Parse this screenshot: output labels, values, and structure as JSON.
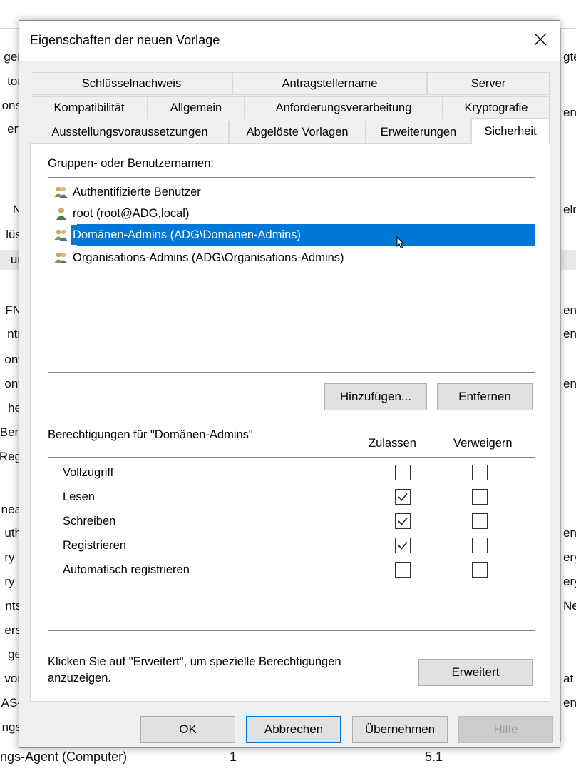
{
  "background": {
    "left_fragments": [
      "ger",
      "tor",
      "ons",
      "ert",
      "N",
      "lüs",
      "ur",
      "FN",
      "ntr",
      "ont",
      "ont",
      "he",
      "Ben",
      "Reg",
      "nea",
      "uth",
      "ry .",
      "ry .",
      "nts",
      "ers",
      "ge",
      "vor",
      "AS-",
      "ngs"
    ],
    "right_fragments": [
      "gte",
      "en",
      "eln",
      "en",
      "en",
      "en",
      "en",
      "ery",
      "ery",
      "Ne",
      "at",
      "en"
    ],
    "bottom_row": {
      "name": "ngs-Agent (Computer)",
      "number": "1",
      "version": "5.1"
    }
  },
  "dialog": {
    "title": "Eigenschaften der neuen Vorlage",
    "close_icon": "close-icon",
    "tabs_row1": [
      "Schlüsselnachweis",
      "Antragstellername",
      "Server"
    ],
    "tabs_row2": [
      "Kompatibilität",
      "Allgemein",
      "Anforderungsverarbeitung",
      "Kryptografie"
    ],
    "tabs_row3": [
      "Ausstellungsvoraussetzungen",
      "Abgelöste Vorlagen",
      "Erweiterungen",
      "Sicherheit"
    ],
    "active_tab": "Sicherheit",
    "groups_label": "Gruppen- oder Benutzernamen:",
    "principals": [
      {
        "name": "Authentifizierte Benutzer",
        "icon": "group-users-icon"
      },
      {
        "name": "root (root@ADG,local)",
        "icon": "user-icon"
      },
      {
        "name": "Domänen-Admins (ADG\\Domänen-Admins)",
        "icon": "group-users-icon",
        "selected": true
      },
      {
        "name": "Organisations-Admins (ADG\\Organisations-Admins)",
        "icon": "group-users-icon"
      }
    ],
    "add_button": "Hinzufügen...",
    "remove_button": "Entfernen",
    "permissions_label": "Berechtigungen für \"Domänen-Admins\"",
    "allow_header": "Zulassen",
    "deny_header": "Verweigern",
    "permissions": [
      {
        "name": "Vollzugriff",
        "allow": false,
        "deny": false
      },
      {
        "name": "Lesen",
        "allow": true,
        "deny": false
      },
      {
        "name": "Schreiben",
        "allow": true,
        "deny": false
      },
      {
        "name": "Registrieren",
        "allow": true,
        "deny": false
      },
      {
        "name": "Automatisch registrieren",
        "allow": false,
        "deny": false
      }
    ],
    "advanced_hint_line1": "Klicken Sie auf \"Erweitert\", um spezielle Berechtigungen",
    "advanced_hint_line2": "anzuzeigen.",
    "advanced_button": "Erweitert",
    "ok_button": "OK",
    "cancel_button": "Abbrechen",
    "apply_button": "Übernehmen",
    "help_button": "Hilfe",
    "colors": {
      "selection": "#0078d7",
      "dialog_bg": "#f0f0f0",
      "button_bg": "#e1e1e1"
    }
  }
}
